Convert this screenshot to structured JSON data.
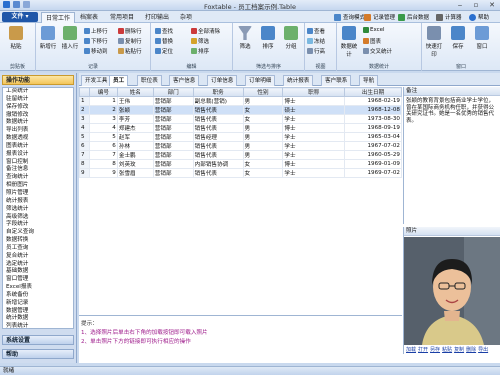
{
  "window": {
    "title": "Foxtable - 员工档案示例.Table"
  },
  "menu": {
    "file": "文件",
    "tabs": [
      "日常工作",
      "档案表",
      "常用项目",
      "打印输出",
      "杂项"
    ],
    "right": [
      "查询模式",
      "记录管理",
      "后台数据",
      "计算器",
      "帮助"
    ]
  },
  "ribbon": {
    "clipboard": {
      "paste": "粘贴",
      "label": "剪贴板"
    },
    "record": {
      "new": "新增行",
      "insert": "插入行",
      "items": [
        "上移行",
        "下移行",
        "移动到",
        "删除行",
        "复制行",
        "粘贴行"
      ],
      "label": "记录"
    },
    "edit": {
      "items": [
        "查找",
        "替换",
        "定位",
        "全部清除",
        "筛选",
        "排序"
      ],
      "label": "编辑"
    },
    "filter": {
      "items": [
        "筛选",
        "排序",
        "分组"
      ],
      "label": "筛选与排序"
    },
    "view": {
      "items": [
        "查看",
        "冻结",
        "隐藏列",
        "行高",
        "列宽"
      ],
      "label": "视图"
    },
    "data": {
      "items": [
        "数据统计",
        "Excel",
        "图表",
        "交叉统计",
        "汇总"
      ],
      "label": "数据统计"
    },
    "window": {
      "items": [
        "快速打印",
        "保存",
        "窗口"
      ],
      "label": "窗口"
    }
  },
  "sidebar": {
    "header": "操作功能",
    "items": [
      "工资统计",
      "驻留统计",
      "保存修改",
      "撤销修改",
      "数据统计",
      "导出列表",
      "数据透视",
      "图表统计",
      "报表设计",
      "窗口控制",
      "备注信息",
      "查询统计",
      "相册图片",
      "照片管理",
      "统计报表",
      "筛选统计",
      "高级筛选",
      "字段统计",
      "自定义查询",
      "数据转换",
      "员工查询",
      "复合统计",
      "选定统计",
      "基础数据",
      "窗口管理",
      "Excel报表",
      "系统备份",
      "新增记录",
      "数据管理",
      "统计数据",
      "列表统计",
      "Excel报表"
    ],
    "footer1": "系统设置",
    "footer2": "帮助"
  },
  "doctabs": [
    "开发工具",
    "员工",
    "职位表",
    "客户信息",
    "订单信息",
    "订单明细",
    "统计报表",
    "客户联系",
    "导航"
  ],
  "grid": {
    "headers": [
      "",
      "编号",
      "姓名",
      "部门",
      "职务",
      "性别",
      "职称",
      "出生日期"
    ],
    "rows": [
      [
        "1",
        "1",
        "王伟",
        "营销部",
        "副总裁(营销)",
        "男",
        "博士",
        "1968-02-19"
      ],
      [
        "2",
        "2",
        "张颖",
        "营销部",
        "销售代表",
        "女",
        "硕士",
        "1968-12-08"
      ],
      [
        "3",
        "3",
        "李芳",
        "营销部",
        "销售代表",
        "女",
        "学士",
        "1973-08-30"
      ],
      [
        "4",
        "4",
        "郑建杰",
        "营销部",
        "销售代表",
        "男",
        "博士",
        "1968-09-19"
      ],
      [
        "5",
        "5",
        "赵军",
        "营销部",
        "销售经理",
        "男",
        "学士",
        "1965-03-04"
      ],
      [
        "6",
        "6",
        "孙林",
        "营销部",
        "销售代表",
        "男",
        "学士",
        "1967-07-02"
      ],
      [
        "7",
        "7",
        "金士鹏",
        "营销部",
        "销售代表",
        "男",
        "学士",
        "1960-05-29"
      ],
      [
        "8",
        "8",
        "刘英玫",
        "营销部",
        "内部销售协调",
        "女",
        "博士",
        "1969-01-09"
      ],
      [
        "9",
        "9",
        "张雪眉",
        "营销部",
        "销售代表",
        "女",
        "学士",
        "1969-07-02"
      ]
    ]
  },
  "memo": {
    "header": "备注",
    "text": "张颖的教育背景包括商业学士学位，曾在某国际商务机构任职，并获得公关研究证书。她是一名优秀的销售代表。"
  },
  "photo": {
    "header": "照片",
    "links": [
      "加载",
      "打开",
      "另存",
      "粘贴",
      "复制",
      "删除",
      "导出"
    ]
  },
  "tip": {
    "label": "提示：",
    "line1": "1、选择照片后单击右下角的加载按钮即可载入照片",
    "line2": "2、单击照片下方的链接即可执行相应的操作"
  },
  "status": "就绪",
  "colors": {
    "accent": "#1f56a8",
    "selected_row": "#cfe0f7",
    "tip_text": "#9d1a8a"
  }
}
